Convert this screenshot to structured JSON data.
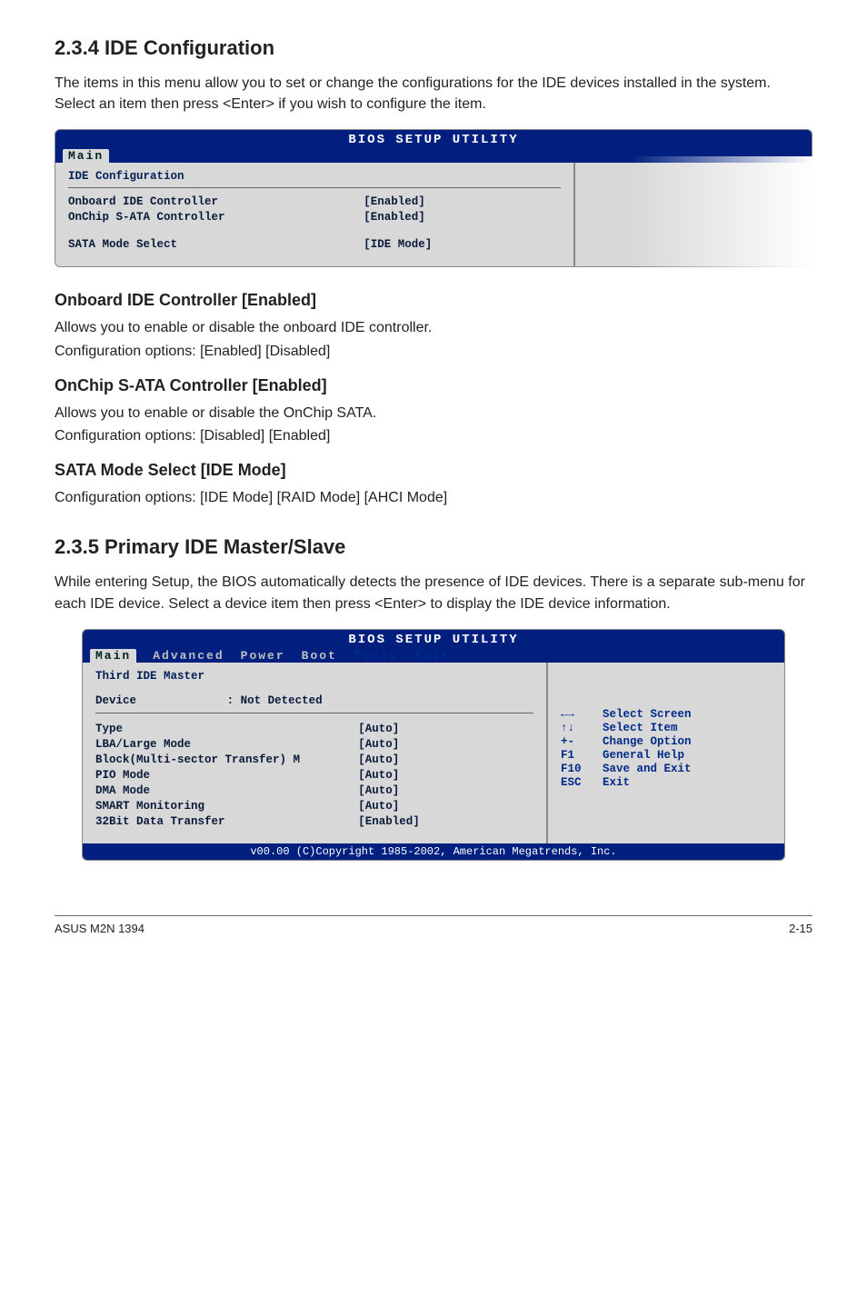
{
  "sections": {
    "s234": {
      "title": "2.3.4      IDE Configuration",
      "intro": "The items in this menu allow you to set or change the configurations for the IDE devices installed in the system. Select an item then press <Enter> if you wish to configure the item.",
      "bios": {
        "headerTitle": "BIOS SETUP UTILITY",
        "tabs": {
          "main": "Main"
        },
        "groupTitle": "IDE Configuration",
        "rows": [
          {
            "lbl": "Onboard IDE Controller",
            "val": "[Enabled]"
          },
          {
            "lbl": "OnChip S-ATA Controller",
            "val": "[Enabled]"
          },
          {
            "lbl": "SATA Mode Select",
            "val": "[IDE Mode]"
          }
        ]
      },
      "subs": [
        {
          "title": "Onboard IDE Controller [Enabled]",
          "body1": "Allows you to enable or disable the onboard IDE controller.",
          "body2": "Configuration options: [Enabled] [Disabled]"
        },
        {
          "title": "OnChip S-ATA Controller [Enabled]",
          "body1": "Allows you to enable or disable the OnChip SATA.",
          "body2": "Configuration options: [Disabled] [Enabled]"
        },
        {
          "title": "SATA Mode Select [IDE Mode]",
          "body1": "Configuration options: [IDE Mode] [RAID Mode] [AHCI Mode]",
          "body2": ""
        }
      ]
    },
    "s235": {
      "title": "2.3.5      Primary IDE Master/Slave",
      "intro": "While entering Setup, the BIOS automatically detects the presence of IDE devices. There is a separate sub-menu for each IDE device. Select a device item then press <Enter> to display the IDE device information.",
      "bios": {
        "headerTitle": "BIOS SETUP UTILITY",
        "tabs": {
          "main": "Main",
          "advanced": "Advanced",
          "power": "Power",
          "boot": "Boot",
          "tools": "Tools",
          "exit": "Exit"
        },
        "groupTitle": "Third IDE Master",
        "deviceLabel": "Device",
        "deviceValue": ": Not Detected",
        "rows": [
          {
            "lbl": "Type",
            "val": "[Auto]"
          },
          {
            "lbl": "LBA/Large Mode",
            "val": "[Auto]"
          },
          {
            "lbl": "Block(Multi-sector Transfer) M",
            "val": "[Auto]"
          },
          {
            "lbl": "PIO Mode",
            "val": "[Auto]"
          },
          {
            "lbl": "DMA Mode",
            "val": "[Auto]"
          },
          {
            "lbl": "SMART Monitoring",
            "val": "[Auto]"
          },
          {
            "lbl": "32Bit Data Transfer",
            "val": "[Enabled]"
          }
        ],
        "help": [
          {
            "key": "←→",
            "txt": "Select Screen"
          },
          {
            "key": "↑↓",
            "txt": "Select Item"
          },
          {
            "key": "+-",
            "txt": "Change Option"
          },
          {
            "key": "F1",
            "txt": "General Help"
          },
          {
            "key": "F10",
            "txt": "Save and Exit"
          },
          {
            "key": "ESC",
            "txt": "Exit"
          }
        ],
        "footer": "v00.00 (C)Copyright 1985-2002, American Megatrends, Inc."
      }
    }
  },
  "footer": {
    "left": "ASUS M2N 1394",
    "right": "2-15"
  }
}
